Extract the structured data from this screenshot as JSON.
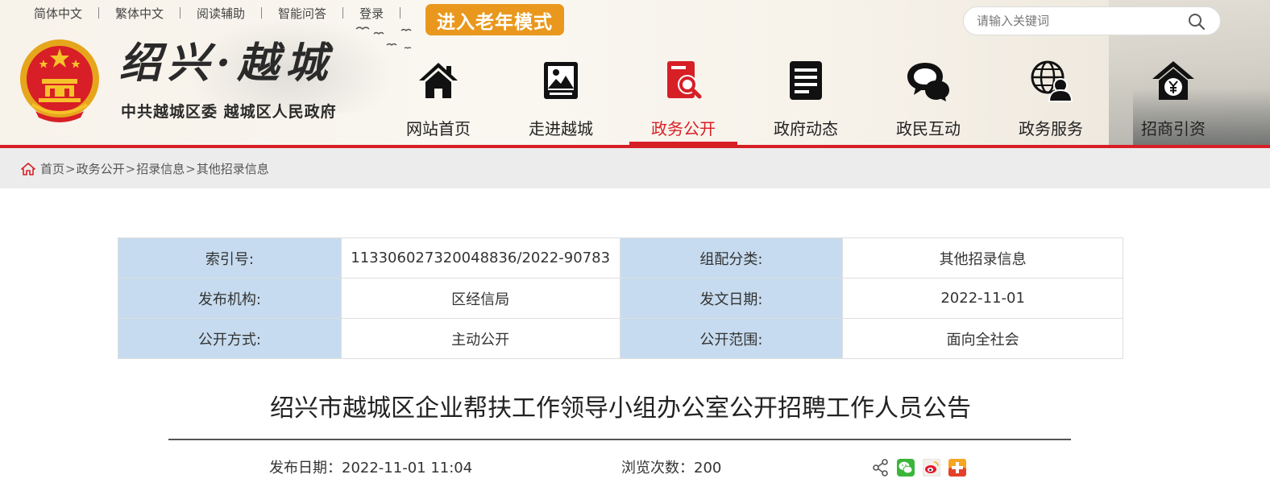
{
  "top_links": [
    "简体中文",
    "繁体中文",
    "阅读辅助",
    "智能问答",
    "登录"
  ],
  "elder_mode": "进入老年模式",
  "search": {
    "placeholder": "请输入关键词"
  },
  "site": {
    "title": "绍兴·越城",
    "subtitle": "中共越城区委 越城区人民政府"
  },
  "nav": [
    {
      "label": "网站首页",
      "icon": "home-icon"
    },
    {
      "label": "走进越城",
      "icon": "picture-icon"
    },
    {
      "label": "政务公开",
      "icon": "document-search-icon",
      "active": true
    },
    {
      "label": "政府动态",
      "icon": "news-list-icon"
    },
    {
      "label": "政民互动",
      "icon": "chat-bubbles-icon"
    },
    {
      "label": "政务服务",
      "icon": "globe-user-icon"
    },
    {
      "label": "招商引资",
      "icon": "house-yuan-icon"
    }
  ],
  "breadcrumb": [
    "首页",
    "政务公开",
    "招录信息",
    "其他招录信息"
  ],
  "meta": {
    "rows": [
      [
        {
          "k": "索引号:",
          "v": "11330602732004883​6/2022-90783"
        },
        {
          "k": "组配分类:",
          "v": "其他招录信息"
        }
      ],
      [
        {
          "k": "发布机构:",
          "v": "区经信局"
        },
        {
          "k": "发文日期:",
          "v": "2022-11-01"
        }
      ],
      [
        {
          "k": "公开方式:",
          "v": "主动公开"
        },
        {
          "k": "公开范围:",
          "v": "面向全社会"
        }
      ]
    ]
  },
  "article": {
    "title": "绍兴市越城区企业帮扶工作领导小组办公室公开招聘工作人员公告",
    "pub_date": "发布日期：2022-11-01 11:04",
    "views": "浏览次数：200"
  },
  "share_icons": [
    "share-icon",
    "wechat-icon",
    "weibo-icon",
    "more-plus-icon"
  ],
  "colors": {
    "accent_red": "#d71f26",
    "elder_orange": "#e9981d",
    "label_blue": "#c6dbef"
  }
}
